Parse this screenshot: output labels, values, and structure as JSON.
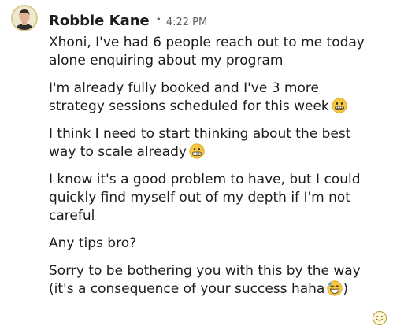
{
  "message": {
    "sender": "Robbie Kane",
    "separator": "•",
    "time": "4:22 PM",
    "paragraphs": [
      [
        "Xhoni, I've had 6 people reach out to me today",
        "alone enquiring about my program"
      ],
      [
        "I'm already fully booked and I've 3 more",
        "strategy sessions scheduled for this week"
      ],
      [
        "I think I need to start thinking about the best",
        "way to scale already"
      ],
      [
        "I know it's a good problem to have, but I could",
        "quickly find myself out of my depth if I'm not",
        "careful"
      ],
      [
        "Any tips bro?"
      ],
      [
        "Sorry to be bothering you with this by the way",
        "(it's a consequence of your success haha",
        ")"
      ]
    ]
  },
  "icons": {
    "avatar": "user-avatar-photo",
    "grimace_emoji": "grimacing-face-icon",
    "sweat_smile_emoji": "grinning-sweat-face-icon",
    "reaction": "add-reaction-icon"
  },
  "colors": {
    "text": "#1d1c1d",
    "meta": "#616061",
    "emoji_yellow": "#f7c83f"
  }
}
